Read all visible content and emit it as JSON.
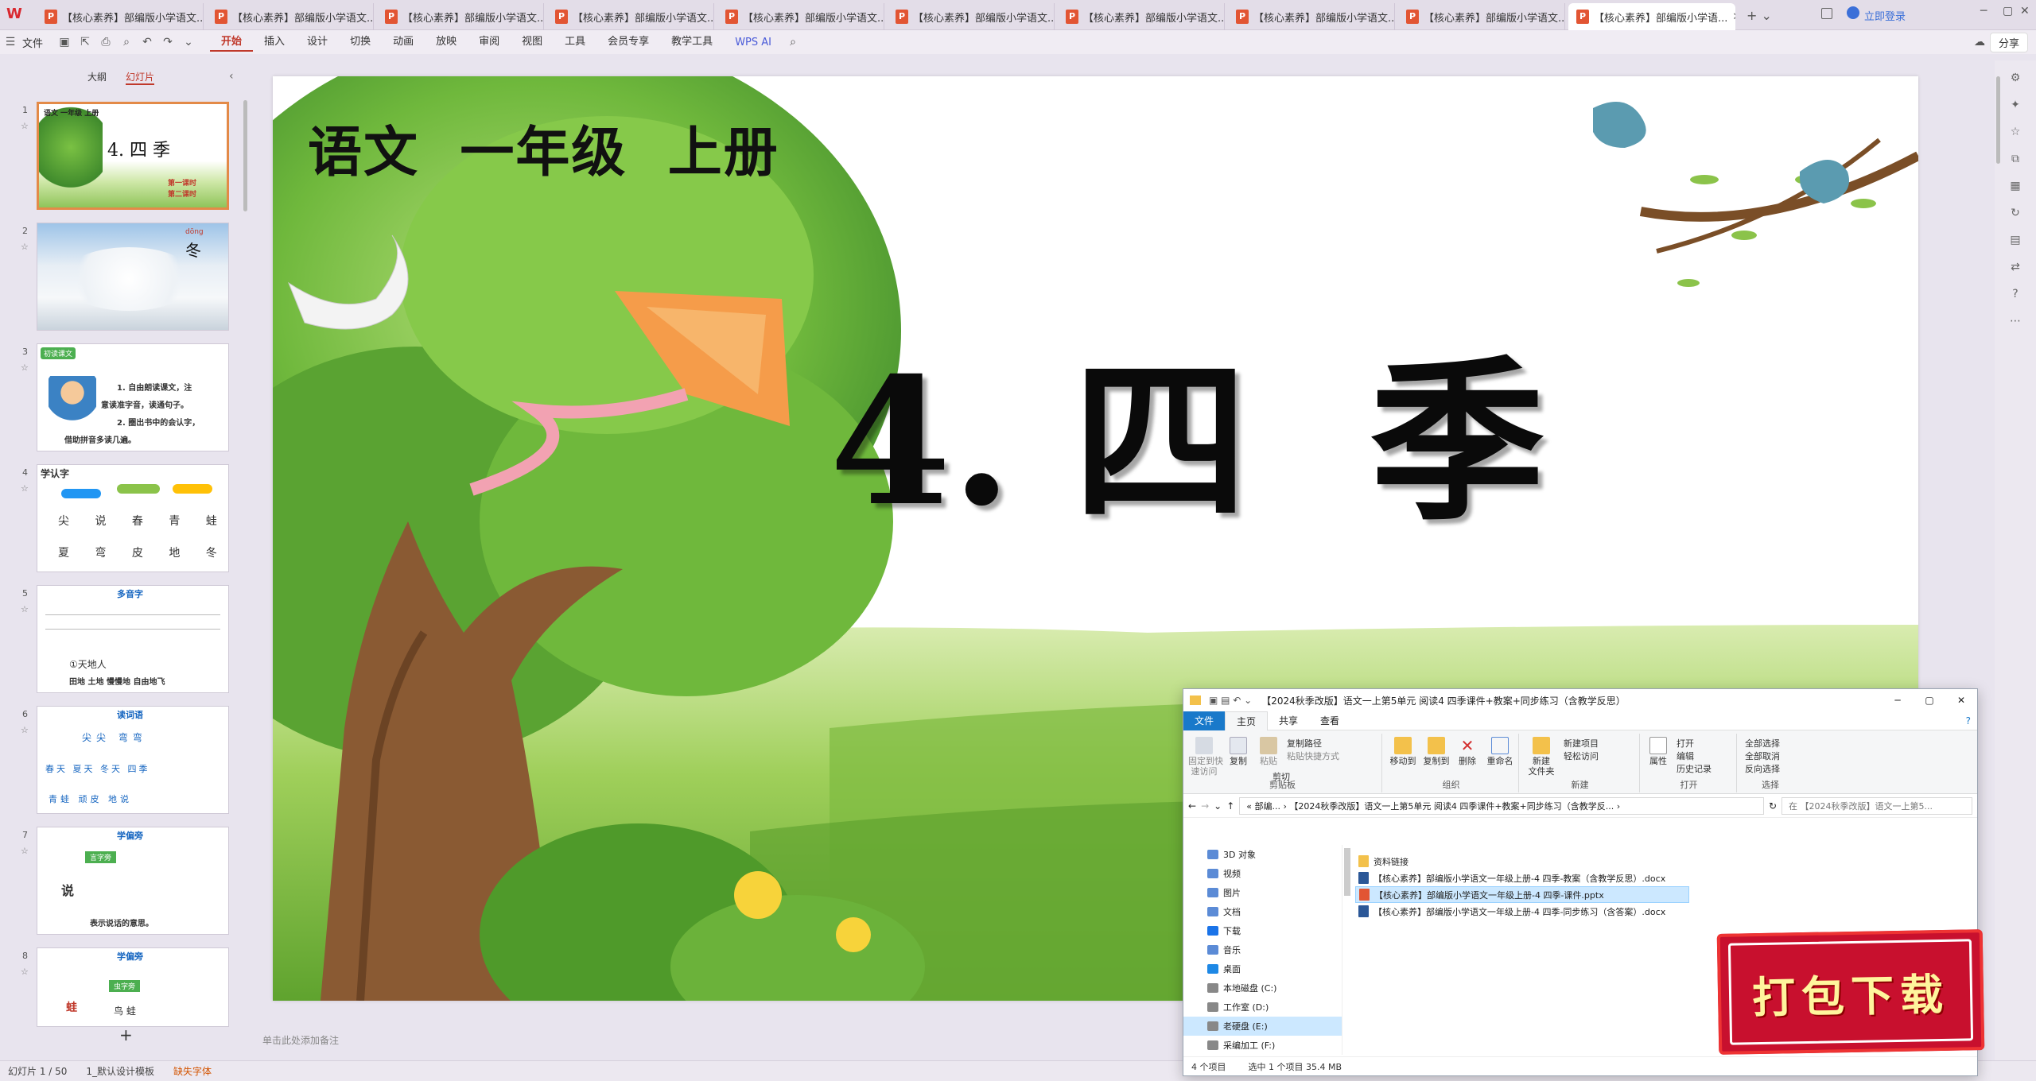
{
  "tabs": [
    {
      "label": "【核心素养】部编版小学语文..."
    },
    {
      "label": "【核心素养】部编版小学语文..."
    },
    {
      "label": "【核心素养】部编版小学语文..."
    },
    {
      "label": "【核心素养】部编版小学语文..."
    },
    {
      "label": "【核心素养】部编版小学语文..."
    },
    {
      "label": "【核心素养】部编版小学语文..."
    },
    {
      "label": "【核心素养】部编版小学语文..."
    },
    {
      "label": "【核心素养】部编版小学语文..."
    },
    {
      "label": "【核心素养】部编版小学语文..."
    },
    {
      "label": "【核心素养】部编版小学语..."
    }
  ],
  "titlebar": {
    "login": "立即登录"
  },
  "menu": {
    "file": "文件",
    "items": [
      "开始",
      "插入",
      "设计",
      "切换",
      "动画",
      "放映",
      "审阅",
      "视图",
      "工具",
      "会员专享",
      "教学工具"
    ],
    "wps_ai": "WPS AI",
    "share": "分享"
  },
  "leftpanel": {
    "tab_outline": "大纲",
    "tab_slides": "幻灯片",
    "thumbs": [
      {
        "num": "1",
        "title": "4. 四 季",
        "subtitle": "语文 一年级 上册",
        "lines": [
          "第一课时",
          "第二课时"
        ]
      },
      {
        "num": "2",
        "title": "冬",
        "pinyin": "dōng"
      },
      {
        "num": "3",
        "title": "初读课文",
        "lines": [
          "1. 自由朗读课文，注",
          "意读准字音，读通句子。",
          "2. 圈出书中的会认字，",
          "借助拼音多读几遍。"
        ]
      },
      {
        "num": "4",
        "title": "学认字",
        "lines": [
          "尖 说 春 青 蛙",
          "夏 弯 皮 地 冬"
        ]
      },
      {
        "num": "5",
        "title": "多音字",
        "lines": [
          "①天地人",
          "田地 土地 慢慢地 自由地飞"
        ]
      },
      {
        "num": "6",
        "title": "读词语",
        "lines": [
          "尖尖 弯弯",
          "春天 夏天 冬天 四季",
          "青蛙 顽皮 地说"
        ]
      },
      {
        "num": "7",
        "title": "学偏旁",
        "lines": [
          "言字旁",
          "说",
          "表示说话的意思。"
        ]
      },
      {
        "num": "8",
        "title": "学偏旁",
        "lines": [
          "虫字旁",
          "蛙",
          "鸟 蛙"
        ]
      }
    ],
    "add": "+"
  },
  "slide": {
    "subject": "语文  一年级  上册",
    "title": "4. 四  季"
  },
  "notes_placeholder": "单击此处添加备注",
  "statusbar": {
    "slide_count": "幻灯片 1 / 50",
    "template": "1_默认设计模板",
    "missing_font": "缺失字体"
  },
  "explorer": {
    "title": "【2024秋季改版】语文一上第5单元 阅读4 四季课件+教案+同步练习（含教学反思）",
    "ribbon_tabs": [
      "文件",
      "主页",
      "共享",
      "查看"
    ],
    "groups": {
      "clipboard": {
        "label": "剪贴板",
        "pin": "固定到快\n速访问",
        "copy": "复制",
        "paste": "粘贴",
        "copy_path": "复制路径",
        "paste_shortcut": "粘贴快捷方式",
        "cut": "剪切"
      },
      "organize": {
        "label": "组织",
        "move_to": "移动到",
        "copy_to": "复制到",
        "delete": "删除",
        "rename": "重命名"
      },
      "new": {
        "label": "新建",
        "new_folder": "新建\n文件夹",
        "new_item": "新建项目",
        "easy_access": "轻松访问"
      },
      "open": {
        "label": "打开",
        "properties": "属性",
        "open": "打开",
        "edit": "编辑",
        "history": "历史记录"
      },
      "select": {
        "label": "选择",
        "select_all": "全部选择",
        "select_none": "全部取消",
        "invert": "反向选择"
      }
    },
    "address": "«  部编...  ›  【2024秋季改版】语文一上第5单元 阅读4 四季课件+教案+同步练习（含教学反...  ›",
    "search_placeholder": "在 【2024秋季改版】语文一上第5...",
    "nav": [
      "3D 对象",
      "视频",
      "图片",
      "文档",
      "下载",
      "音乐",
      "桌面",
      "本地磁盘 (C:)",
      "工作室 (D:)",
      "老硬盘 (E:)",
      "采编加工 (F:)"
    ],
    "nav_selected": "老硬盘 (E:)",
    "files": [
      {
        "name": "资料链接",
        "type": "folder"
      },
      {
        "name": "【核心素养】部编版小学语文一年级上册-4 四季-教案（含教学反思）.docx",
        "type": "docx"
      },
      {
        "name": "【核心素养】部编版小学语文一年级上册-4 四季-课件.pptx",
        "type": "pptx",
        "selected": true
      },
      {
        "name": "【核心素养】部编版小学语文一年级上册-4 四季-同步练习（含答案）.docx",
        "type": "docx"
      }
    ],
    "status": {
      "count": "4 个项目",
      "selected": "选中 1 个项目  35.4 MB"
    }
  },
  "stamp": {
    "text": "打包下载"
  },
  "colors": {
    "accent": "#c0392b",
    "ppt_icon": "#e25533",
    "folder": "#f3c14b",
    "word": "#2b5797",
    "explorer_blue": "#1979ca"
  }
}
